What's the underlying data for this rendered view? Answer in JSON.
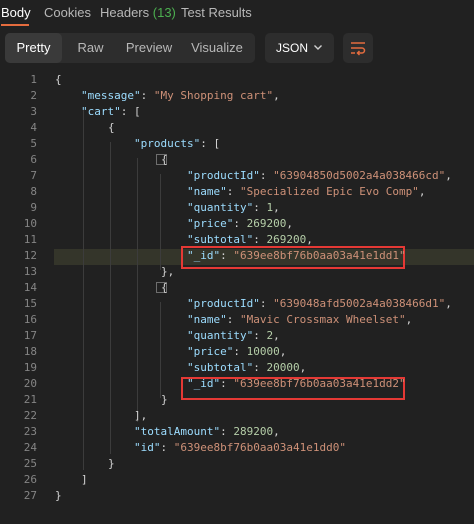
{
  "tabs": [
    {
      "label": "Body",
      "active": true
    },
    {
      "label": "Cookies"
    },
    {
      "label": "Headers",
      "count": "(13)"
    },
    {
      "label": "Test Results"
    }
  ],
  "view_modes": [
    "Pretty",
    "Raw",
    "Preview",
    "Visualize"
  ],
  "active_view": "Pretty",
  "format": {
    "label": "JSON",
    "icon": "chevron-down-icon"
  },
  "wrap_icon": "wrap-lines-icon",
  "colors": {
    "accent": "#e56c3e",
    "count": "#4caf50",
    "highlight_box": "#e53935"
  },
  "lines": [
    {
      "n": "1",
      "t": [
        {
          "c": "p",
          "v": "{"
        }
      ]
    },
    {
      "n": "2",
      "t": [
        {
          "c": "k",
          "v": "\"message\""
        },
        {
          "c": "p",
          "v": ": "
        },
        {
          "c": "s",
          "v": "\"My Shopping cart\""
        },
        {
          "c": "p",
          "v": ","
        }
      ]
    },
    {
      "n": "3",
      "t": [
        {
          "c": "k",
          "v": "\"cart\""
        },
        {
          "c": "p",
          "v": ": ["
        }
      ]
    },
    {
      "n": "4",
      "t": [
        {
          "c": "p",
          "v": "{"
        }
      ]
    },
    {
      "n": "5",
      "t": [
        {
          "c": "k",
          "v": "\"products\""
        },
        {
          "c": "p",
          "v": ": ["
        }
      ]
    },
    {
      "n": "6",
      "t": [
        {
          "c": "p",
          "v": "{"
        }
      ]
    },
    {
      "n": "7",
      "t": [
        {
          "c": "k",
          "v": "\"productId\""
        },
        {
          "c": "p",
          "v": ": "
        },
        {
          "c": "s",
          "v": "\"63904850d5002a4a038466cd\""
        },
        {
          "c": "p",
          "v": ","
        }
      ]
    },
    {
      "n": "8",
      "t": [
        {
          "c": "k",
          "v": "\"name\""
        },
        {
          "c": "p",
          "v": ": "
        },
        {
          "c": "s",
          "v": "\"Specialized Epic Evo Comp\""
        },
        {
          "c": "p",
          "v": ","
        }
      ]
    },
    {
      "n": "9",
      "t": [
        {
          "c": "k",
          "v": "\"quantity\""
        },
        {
          "c": "p",
          "v": ": "
        },
        {
          "c": "n",
          "v": "1"
        },
        {
          "c": "p",
          "v": ","
        }
      ]
    },
    {
      "n": "10",
      "t": [
        {
          "c": "k",
          "v": "\"price\""
        },
        {
          "c": "p",
          "v": ": "
        },
        {
          "c": "n",
          "v": "269200"
        },
        {
          "c": "p",
          "v": ","
        }
      ]
    },
    {
      "n": "11",
      "t": [
        {
          "c": "k",
          "v": "\"subtotal\""
        },
        {
          "c": "p",
          "v": ": "
        },
        {
          "c": "n",
          "v": "269200"
        },
        {
          "c": "p",
          "v": ","
        }
      ]
    },
    {
      "n": "12",
      "t": [
        {
          "c": "k",
          "v": "\"_id\""
        },
        {
          "c": "p",
          "v": ": "
        },
        {
          "c": "s",
          "v": "\"639ee8bf76b0aa03a41e1dd1\""
        }
      ]
    },
    {
      "n": "13",
      "t": [
        {
          "c": "p",
          "v": "},"
        }
      ]
    },
    {
      "n": "14",
      "t": [
        {
          "c": "p",
          "v": "{"
        }
      ]
    },
    {
      "n": "15",
      "t": [
        {
          "c": "k",
          "v": "\"productId\""
        },
        {
          "c": "p",
          "v": ": "
        },
        {
          "c": "s",
          "v": "\"639048afd5002a4a038466d1\""
        },
        {
          "c": "p",
          "v": ","
        }
      ]
    },
    {
      "n": "16",
      "t": [
        {
          "c": "k",
          "v": "\"name\""
        },
        {
          "c": "p",
          "v": ": "
        },
        {
          "c": "s",
          "v": "\"Mavic Crossmax Wheelset\""
        },
        {
          "c": "p",
          "v": ","
        }
      ]
    },
    {
      "n": "17",
      "t": [
        {
          "c": "k",
          "v": "\"quantity\""
        },
        {
          "c": "p",
          "v": ": "
        },
        {
          "c": "n",
          "v": "2"
        },
        {
          "c": "p",
          "v": ","
        }
      ]
    },
    {
      "n": "18",
      "t": [
        {
          "c": "k",
          "v": "\"price\""
        },
        {
          "c": "p",
          "v": ": "
        },
        {
          "c": "n",
          "v": "10000"
        },
        {
          "c": "p",
          "v": ","
        }
      ]
    },
    {
      "n": "19",
      "t": [
        {
          "c": "k",
          "v": "\"subtotal\""
        },
        {
          "c": "p",
          "v": ": "
        },
        {
          "c": "n",
          "v": "20000"
        },
        {
          "c": "p",
          "v": ","
        }
      ]
    },
    {
      "n": "20",
      "t": [
        {
          "c": "k",
          "v": "\"_id\""
        },
        {
          "c": "p",
          "v": ": "
        },
        {
          "c": "s",
          "v": "\"639ee8bf76b0aa03a41e1dd2\""
        }
      ]
    },
    {
      "n": "21",
      "t": [
        {
          "c": "p",
          "v": "}"
        }
      ]
    },
    {
      "n": "22",
      "t": [
        {
          "c": "p",
          "v": "],"
        }
      ]
    },
    {
      "n": "23",
      "t": [
        {
          "c": "k",
          "v": "\"totalAmount\""
        },
        {
          "c": "p",
          "v": ": "
        },
        {
          "c": "n",
          "v": "289200"
        },
        {
          "c": "p",
          "v": ","
        }
      ]
    },
    {
      "n": "24",
      "t": [
        {
          "c": "k",
          "v": "\"id\""
        },
        {
          "c": "p",
          "v": ": "
        },
        {
          "c": "s",
          "v": "\"639ee8bf76b0aa03a41e1dd0\""
        }
      ]
    },
    {
      "n": "25",
      "t": [
        {
          "c": "p",
          "v": "}"
        }
      ]
    },
    {
      "n": "26",
      "t": [
        {
          "c": "p",
          "v": "]"
        }
      ]
    },
    {
      "n": "27",
      "t": [
        {
          "c": "p",
          "v": "}"
        }
      ]
    }
  ]
}
